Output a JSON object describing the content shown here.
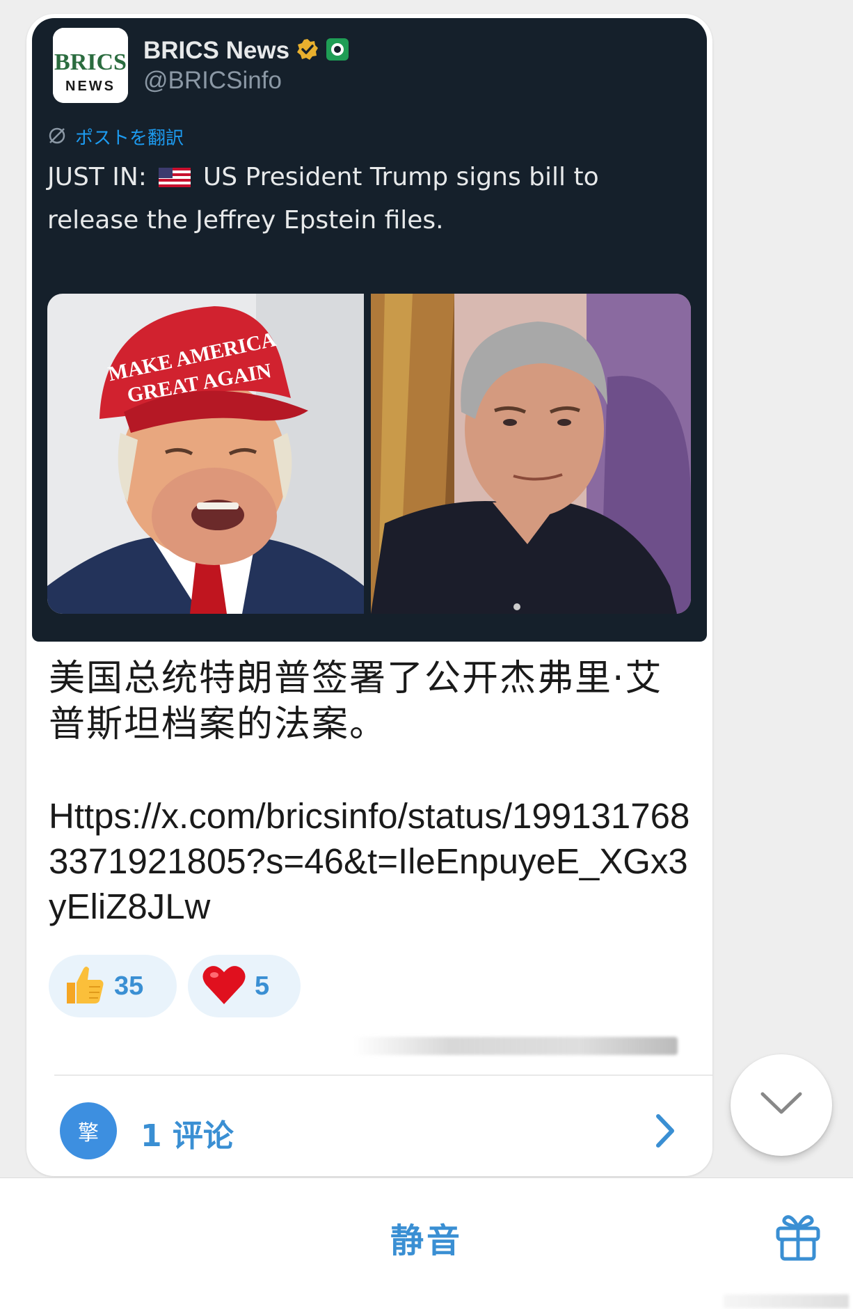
{
  "tweet": {
    "account_name": "BRICS News",
    "handle": "@BRICSinfo",
    "avatar_logo_text": "BRICS",
    "avatar_logo_subtext": "NEWS",
    "translate_label": "ポストを翻訳",
    "text_before_flag": "JUST IN:",
    "text_after_flag": "US President Trump signs bill to release the Jeffrey Epstein files.",
    "verified_badge_color": "#e8b02e",
    "affiliate_badge_color": "#1f9d55",
    "images": [
      {
        "subject": "man-in-red-cap-photo",
        "cap_text": "MAKE AMERICA GREAT AGAIN"
      },
      {
        "subject": "man-in-dark-polo-photo"
      }
    ]
  },
  "message": {
    "caption": "美国总统特朗普签署了公开杰弗里·艾普斯坦档案的法案。",
    "link": "Https://x.com/bricsinfo/status/1991317683371921805?s=46&t=IleEnpuyeE_XGx3yEliZ8JLw"
  },
  "reactions": [
    {
      "icon": "thumbs-up-icon",
      "count": "35"
    },
    {
      "icon": "heart-icon",
      "count": "5"
    }
  ],
  "comments": {
    "avatar_char": "擎",
    "label": "1 评论"
  },
  "bottom_bar": {
    "mute_label": "静音"
  },
  "colors": {
    "accent": "#3a8fd3",
    "tweet_bg": "#15202b",
    "link_blue": "#1d9bf0"
  }
}
